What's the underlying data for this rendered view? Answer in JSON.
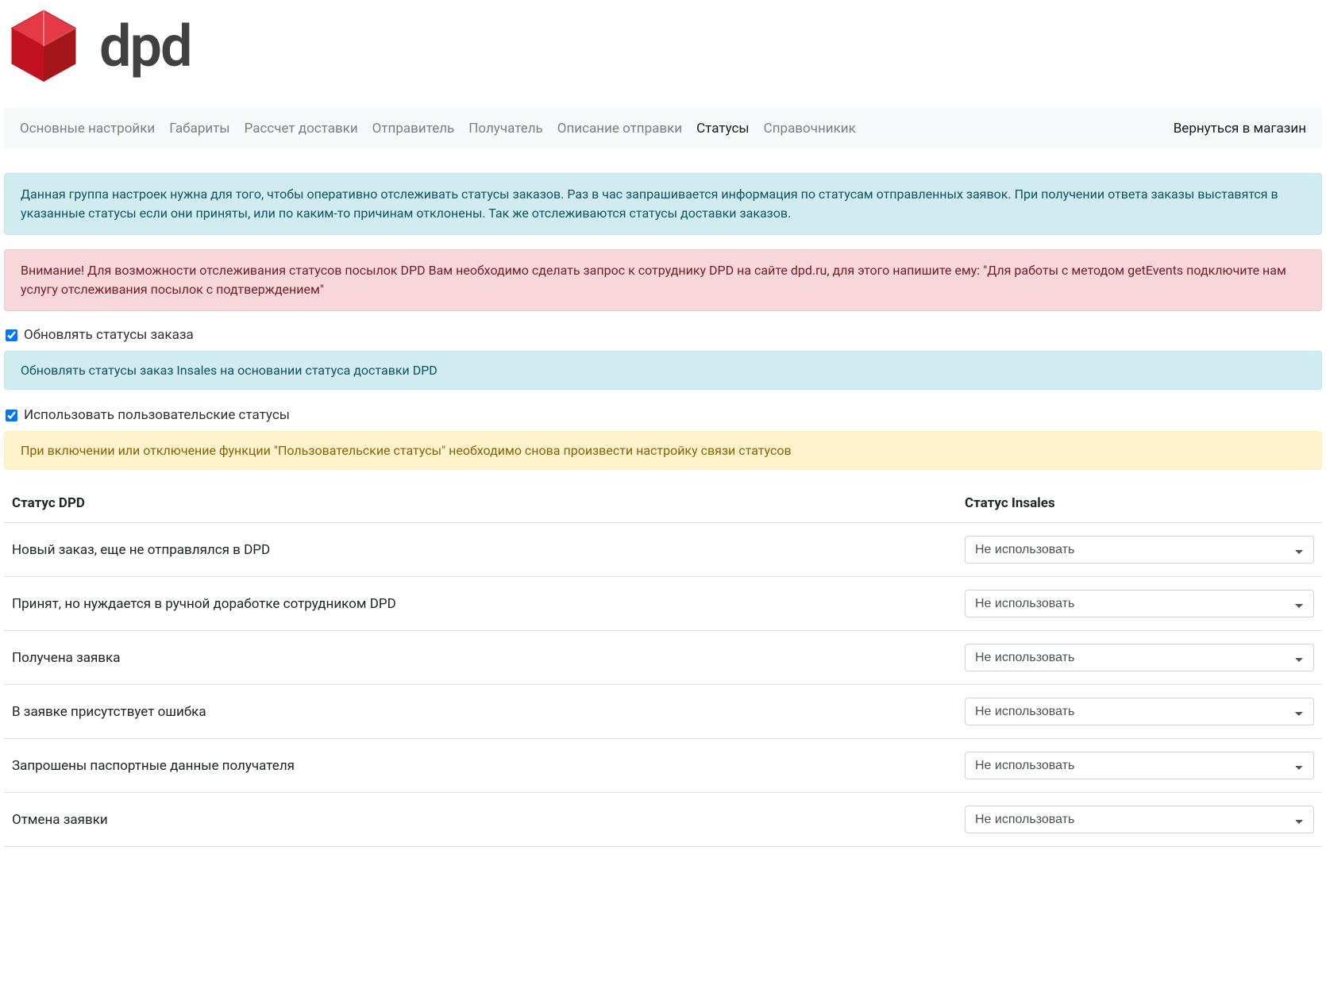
{
  "logo": {
    "text": "dpd"
  },
  "nav": {
    "items": [
      {
        "label": "Основные настройки"
      },
      {
        "label": "Габариты"
      },
      {
        "label": "Рассчет доставки"
      },
      {
        "label": "Отправитель"
      },
      {
        "label": "Получатель"
      },
      {
        "label": "Описание отправки"
      },
      {
        "label": "Статусы"
      },
      {
        "label": "Справочникик"
      }
    ],
    "right": "Вернуться в магазин"
  },
  "alerts": {
    "info1": "Данная группа настроек нужна для того, чтобы оперативно отслеживать статусы заказов. Раз в час запрашивается информация по статусам отправленных заявок. При получении ответа заказы выставятся в указанные статусы если они приняты, или по каким-то причинам отклонены. Так же отслеживаются статусы доставки заказов.",
    "danger1": "Внимание! Для возможности отслеживания статусов посылок DPD Вам необходимо сделать запрос к сотруднику DPD на сайте dpd.ru, для этого напишите ему: \"Для работы с методом getEvents подключите нам услугу отслеживания посылок с подтверждением\"",
    "check1_label": "Обновлять статусы заказа",
    "info2": "Обновлять статусы заказ Insales на основании статуса доставки DPD",
    "check2_label": "Использовать пользовательские статусы",
    "warning1": "При включении или отключение функции \"Пользовательские статусы\" необходимо снова произвести настройку связи статусов"
  },
  "table": {
    "header_dpd": "Статус DPD",
    "header_insales": "Статус Insales",
    "select_default": "Не использовать",
    "rows": [
      {
        "label": "Новый заказ, еще не отправлялся в DPD"
      },
      {
        "label": "Принят, но нуждается в ручной доработке сотрудником DPD"
      },
      {
        "label": "Получена заявка"
      },
      {
        "label": "В заявке присутствует ошибка"
      },
      {
        "label": "Запрошены паспортные данные получателя"
      },
      {
        "label": "Отмена заявки"
      }
    ]
  }
}
